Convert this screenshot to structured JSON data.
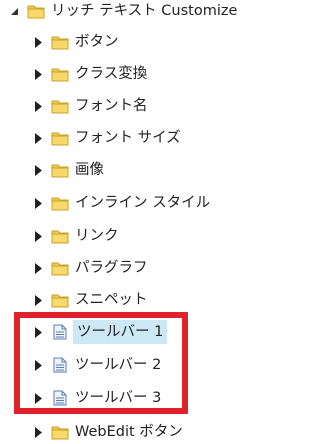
{
  "tree": {
    "root": {
      "label": "リッチ テキスト Customize",
      "icon": "folder-icon",
      "expanded": true
    },
    "items": [
      {
        "label": "ボタン",
        "icon": "folder-icon"
      },
      {
        "label": "クラス変換",
        "icon": "folder-icon"
      },
      {
        "label": "フォント名",
        "icon": "folder-icon"
      },
      {
        "label": "フォント サイズ",
        "icon": "folder-icon"
      },
      {
        "label": "画像",
        "icon": "folder-icon"
      },
      {
        "label": "インライン スタイル",
        "icon": "folder-icon"
      },
      {
        "label": "リンク",
        "icon": "folder-icon"
      },
      {
        "label": "パラグラフ",
        "icon": "folder-icon"
      },
      {
        "label": "スニペット",
        "icon": "folder-icon"
      },
      {
        "label": "ツールバー 1",
        "icon": "document-icon",
        "selected": true
      },
      {
        "label": "ツールバー 2",
        "icon": "document-icon"
      },
      {
        "label": "ツールバー 3",
        "icon": "document-icon"
      },
      {
        "label": "WebEdit ボタン",
        "icon": "folder-icon"
      }
    ]
  },
  "colors": {
    "selection": "#cce8f6",
    "highlight_border": "#e0232a",
    "folder": "#f2c94c"
  }
}
